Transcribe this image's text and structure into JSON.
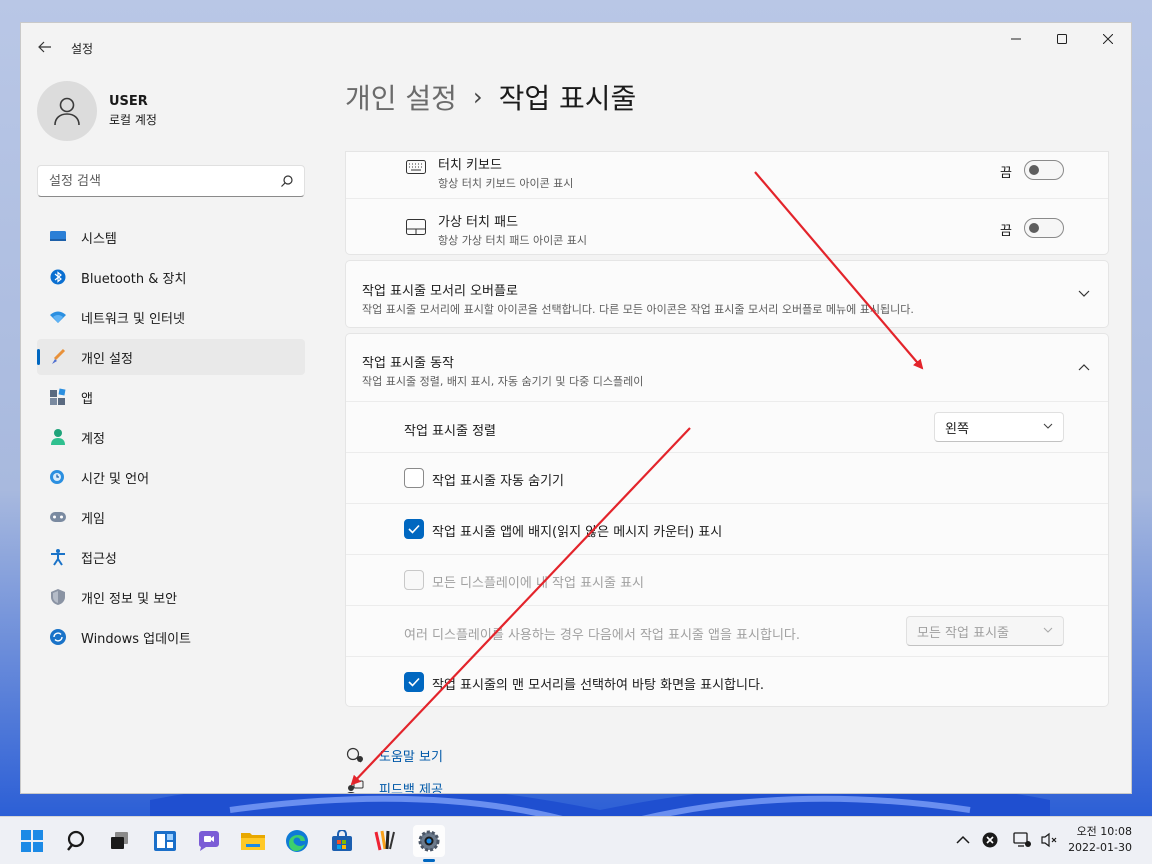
{
  "window": {
    "title": "설정",
    "back_label": "←"
  },
  "user": {
    "name": "USER",
    "account_type": "로컬 계정"
  },
  "search": {
    "placeholder": "설정 검색"
  },
  "nav": {
    "items": [
      {
        "label": "시스템",
        "icon": "monitor-icon"
      },
      {
        "label": "Bluetooth & 장치",
        "icon": "bluetooth-icon"
      },
      {
        "label": "네트워크 및 인터넷",
        "icon": "wifi-icon"
      },
      {
        "label": "개인 설정",
        "icon": "brush-icon",
        "active": true
      },
      {
        "label": "앱",
        "icon": "apps-icon"
      },
      {
        "label": "계정",
        "icon": "person-icon"
      },
      {
        "label": "시간 및 언어",
        "icon": "globe-clock-icon"
      },
      {
        "label": "게임",
        "icon": "gamepad-icon"
      },
      {
        "label": "접근성",
        "icon": "accessibility-icon"
      },
      {
        "label": "개인 정보 및 보안",
        "icon": "shield-icon"
      },
      {
        "label": "Windows 업데이트",
        "icon": "update-icon"
      }
    ]
  },
  "breadcrumb": {
    "parent": "개인 설정",
    "separator": "›",
    "current": "작업 표시줄"
  },
  "tray_icons": {
    "touch_keyboard": {
      "title": "터치 키보드",
      "subtitle": "항상 터치 키보드 아이콘 표시",
      "state_label": "끔"
    },
    "virtual_touchpad": {
      "title": "가상 터치 패드",
      "subtitle": "항상 가상 터치 패드 아이콘 표시",
      "state_label": "끔"
    }
  },
  "overflow": {
    "title": "작업 표시줄 모서리 오버플로",
    "subtitle": "작업 표시줄 모서리에 표시할 아이콘을 선택합니다. 다른 모든 아이콘은 작업 표시줄 모서리 오버플로 메뉴에 표시됩니다."
  },
  "behaviors": {
    "title": "작업 표시줄 동작",
    "subtitle": "작업 표시줄 정렬, 배지 표시, 자동 숨기기 및 다중 디스플레이",
    "alignment_label": "작업 표시줄 정렬",
    "alignment_value": "왼쪽",
    "auto_hide_label": "작업 표시줄 자동 숨기기",
    "badges_label": "작업 표시줄 앱에 배지(읽지 않은 메시지 카운터) 표시",
    "all_displays_label": "모든 디스플레이에 내 작업 표시줄 표시",
    "multi_display_label": "여러 디스플레이를 사용하는 경우 다음에서 작업 표시줄 앱을 표시합니다.",
    "multi_display_value": "모든 작업 표시줄",
    "show_desktop_label": "작업 표시줄의 맨 모서리를 선택하여 바탕 화면을 표시합니다.",
    "auto_hide_checked": false,
    "badges_checked": true,
    "all_displays_checked": false,
    "show_desktop_checked": true
  },
  "links": {
    "help": "도움말 보기",
    "feedback": "피드백 제공"
  },
  "clock": {
    "time": "오전 10:08",
    "date": "2022-01-30"
  },
  "colors": {
    "accent": "#0067c0",
    "arrow": "#e3242b"
  }
}
